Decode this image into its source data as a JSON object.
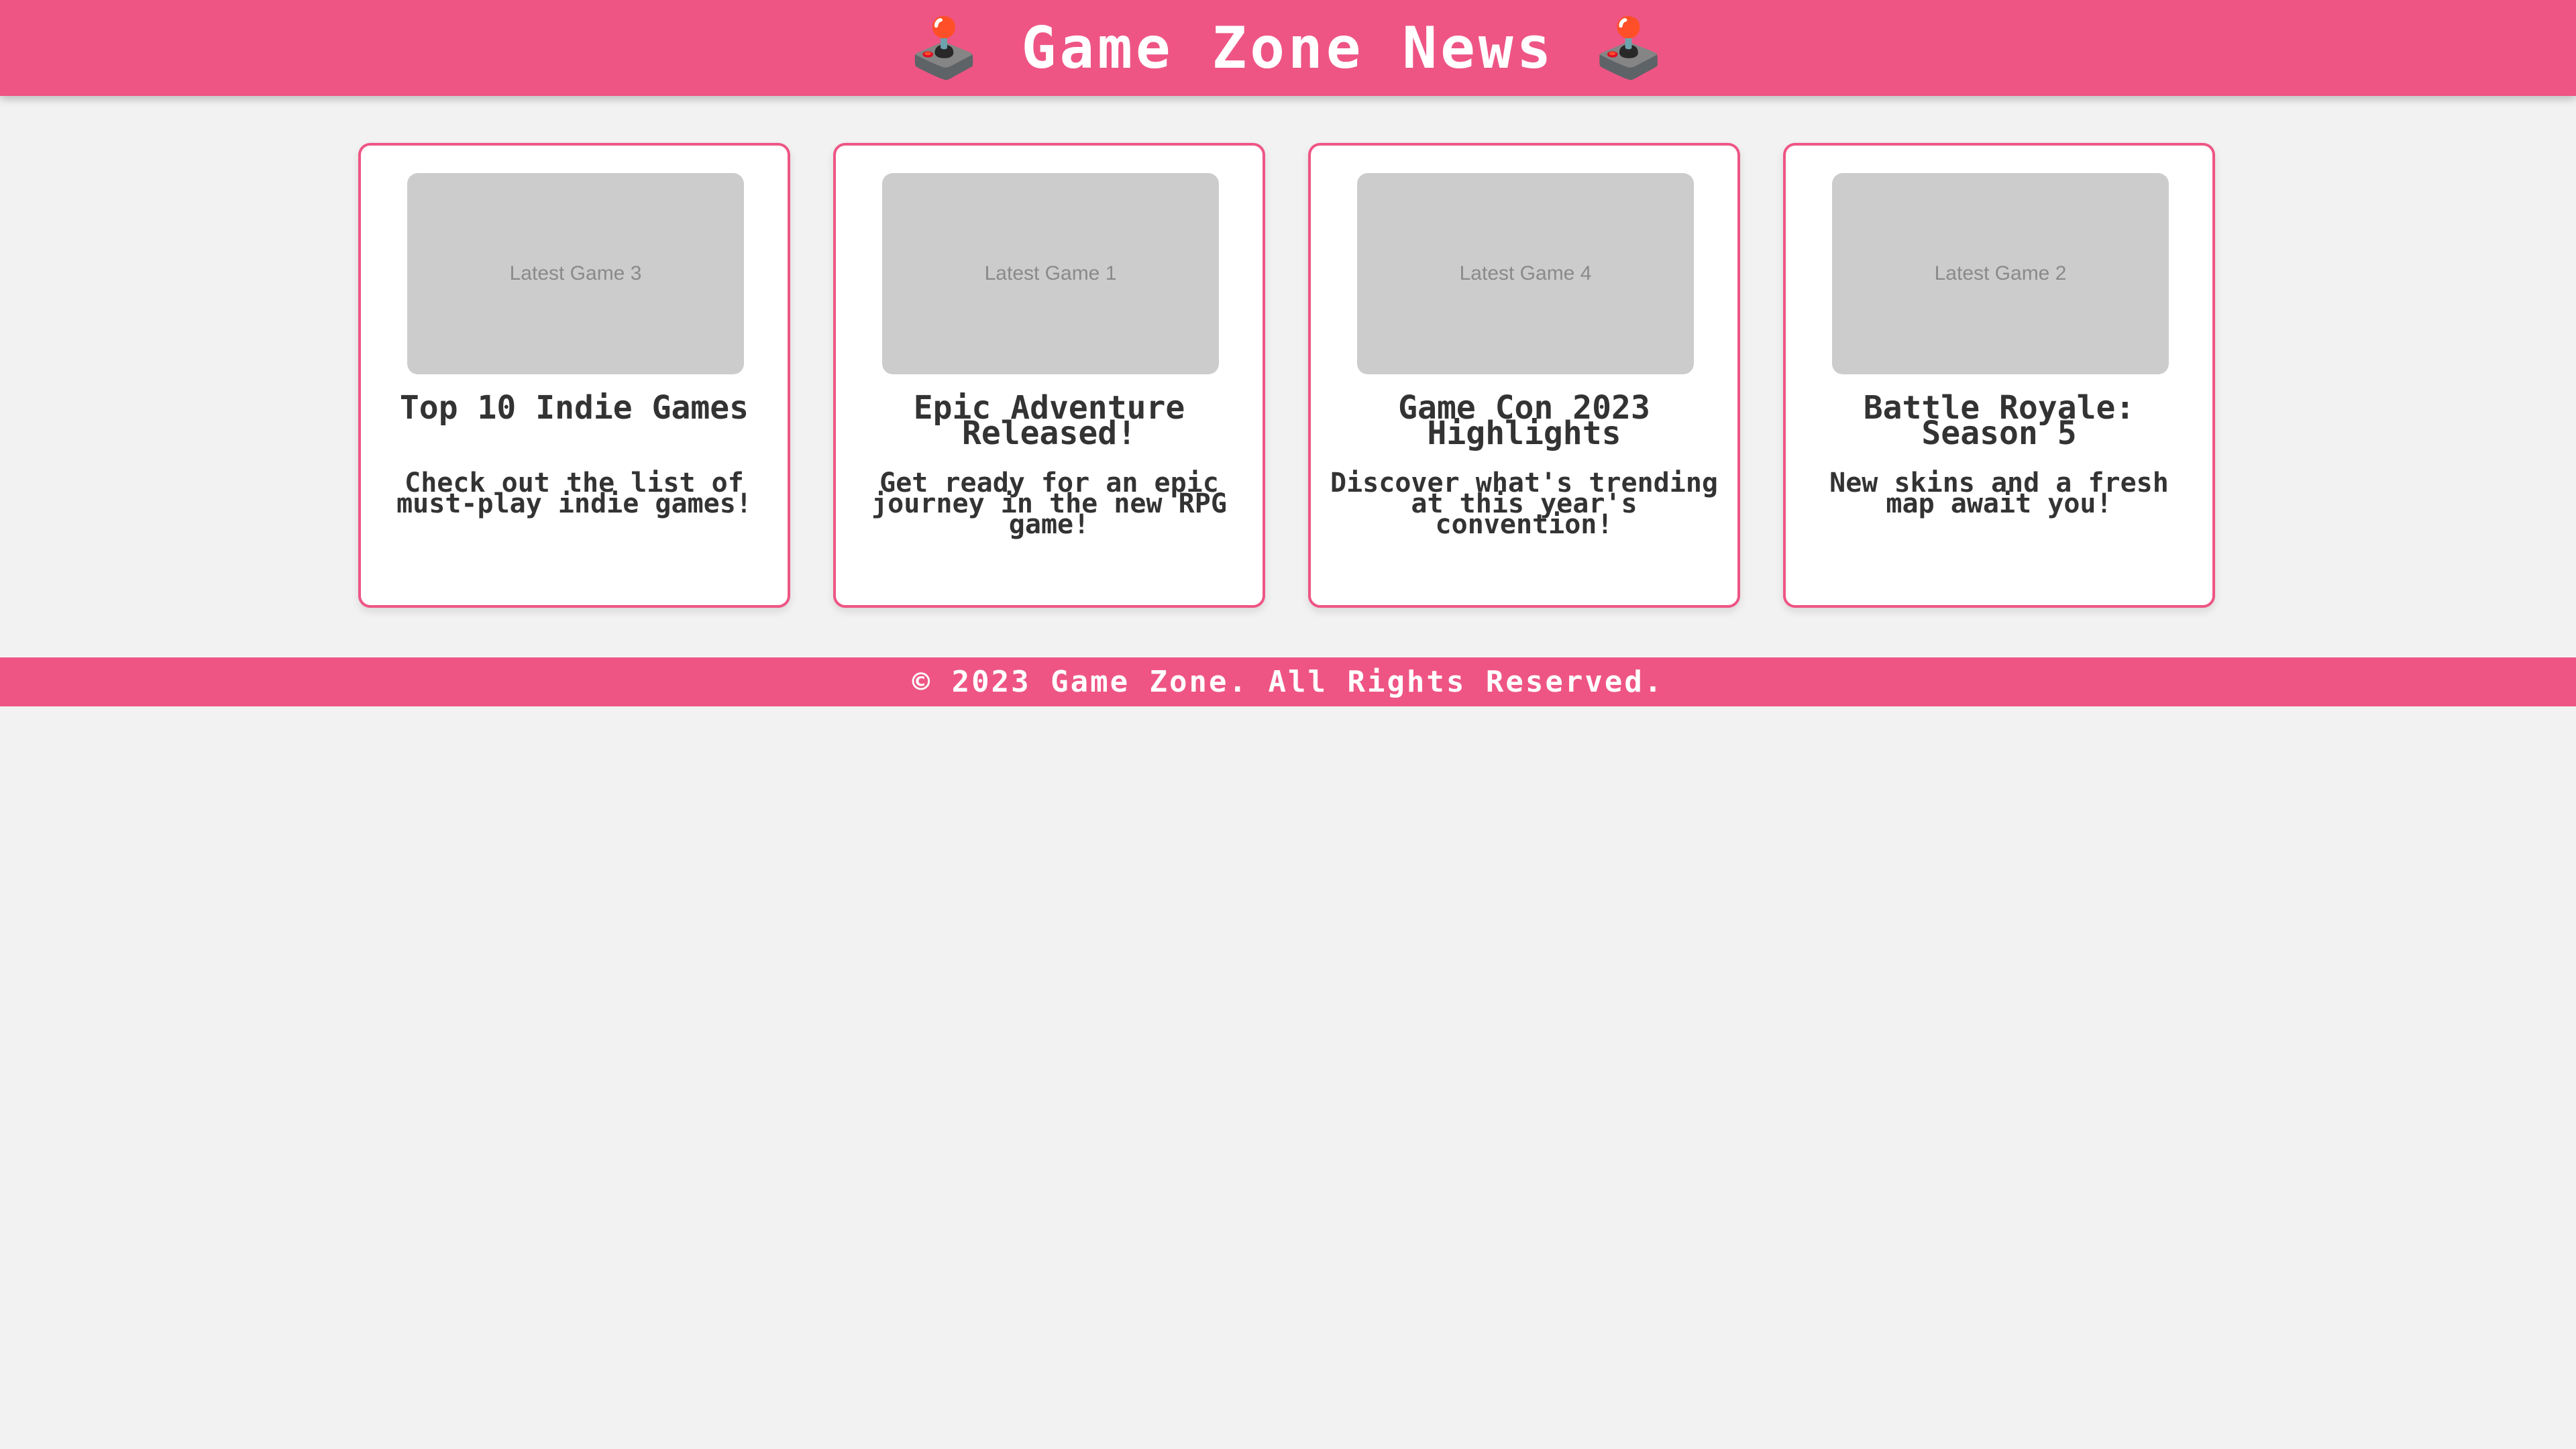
{
  "header": {
    "title": "🕹️ Game Zone News 🕹️"
  },
  "colors": {
    "accent": "#ee5585",
    "background": "#f2f2f2",
    "card_background": "#ffffff",
    "image_placeholder": "#cccccc",
    "text": "#333333"
  },
  "cards": [
    {
      "image_label": "Latest Game 3",
      "title": "Top 10 Indie Games",
      "description": "Check out the list of must-play indie games!"
    },
    {
      "image_label": "Latest Game 1",
      "title": "Epic Adventure Released!",
      "description": "Get ready for an epic journey in the new RPG game!"
    },
    {
      "image_label": "Latest Game 4",
      "title": "Game Con 2023 Highlights",
      "description": "Discover what's trending at this year's convention!"
    },
    {
      "image_label": "Latest Game 2",
      "title": "Battle Royale: Season 5",
      "description": "New skins and a fresh map await you!"
    }
  ],
  "footer": {
    "text": "© 2023 Game Zone. All Rights Reserved."
  }
}
